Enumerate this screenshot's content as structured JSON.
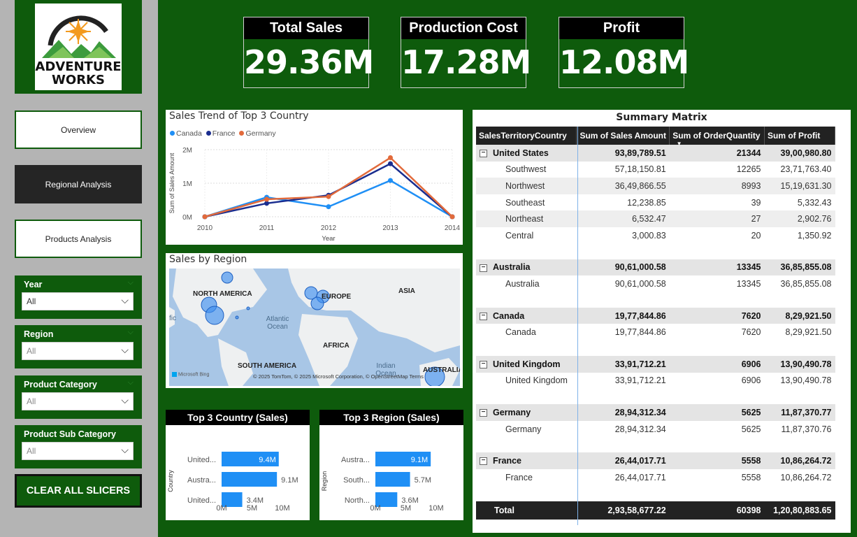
{
  "logo": {
    "line1": "ADVENTURE",
    "line2": "WORKS"
  },
  "nav": [
    {
      "label": "Overview",
      "active": false
    },
    {
      "label": "Regional Analysis",
      "active": true
    },
    {
      "label": "Products Analysis",
      "active": false
    }
  ],
  "slicers": [
    {
      "title": "Year",
      "value": "All"
    },
    {
      "title": "Region",
      "value": "All"
    },
    {
      "title": "Product Category",
      "value": "All"
    },
    {
      "title": "Product Sub Category",
      "value": "All"
    }
  ],
  "clear_button": "CLEAR ALL SLICERS",
  "kpis": [
    {
      "title": "Total Sales",
      "value": "29.36M"
    },
    {
      "title": "Production Cost",
      "value": "17.28M"
    },
    {
      "title": "Profit",
      "value": "12.08M"
    }
  ],
  "trend": {
    "title": "Sales Trend of Top 3 Country",
    "legend": [
      "Canada",
      "France",
      "Germany"
    ],
    "colors": {
      "Canada": "#1f8ff5",
      "France": "#1a2d8f",
      "Germany": "#e26a3b"
    }
  },
  "map": {
    "title": "Sales by Region",
    "labels": {
      "na": "NORTH AMERICA",
      "eu": "EUROPE",
      "asia": "ASIA",
      "africa": "AFRICA",
      "sa": "SOUTH AMERICA",
      "au": "AUSTRALIA",
      "atlantic": "Atlantic Ocean",
      "indian": "Indian Ocean",
      "pacific": "fic"
    },
    "attribution": "© 2025 TomTom, © 2025 Microsoft Corporation, © OpenStreetMap Terms",
    "bing": "Microsoft Bing"
  },
  "top_country": {
    "title": "Top 3 Country (Sales)",
    "ylabel": "Country"
  },
  "top_region": {
    "title": "Top 3 Region (Sales)",
    "ylabel": "Region"
  },
  "chart_data": [
    {
      "type": "line",
      "title": "Sales Trend of Top 3 Country",
      "x": [
        2010,
        2011,
        2012,
        2013,
        2014
      ],
      "xlabel": "Year",
      "ylabel": "Sum of Sales Amount",
      "yticks": [
        "0M",
        "1M",
        "2M"
      ],
      "ylim": [
        0,
        2000000
      ],
      "series": [
        {
          "name": "Canada",
          "values": [
            0,
            580000,
            300000,
            1080000,
            0
          ]
        },
        {
          "name": "France",
          "values": [
            0,
            400000,
            640000,
            1580000,
            0
          ]
        },
        {
          "name": "Germany",
          "values": [
            0,
            520000,
            600000,
            1760000,
            0
          ]
        }
      ],
      "legend_position": "top-left"
    },
    {
      "type": "bar",
      "title": "Top 3 Country (Sales)",
      "categories": [
        "United...",
        "Austra...",
        "United..."
      ],
      "values": [
        9.4,
        9.1,
        3.4
      ],
      "data_labels": [
        "9.4M",
        "9.1M",
        "3.4M"
      ],
      "xticks": [
        "0M",
        "5M",
        "10M"
      ],
      "xlim": [
        0,
        10
      ],
      "ylabel": "Country"
    },
    {
      "type": "bar",
      "title": "Top 3 Region (Sales)",
      "categories": [
        "Austra...",
        "South...",
        "North..."
      ],
      "values": [
        9.1,
        5.7,
        3.6
      ],
      "data_labels": [
        "9.1M",
        "5.7M",
        "3.6M"
      ],
      "xticks": [
        "0M",
        "5M",
        "10M"
      ],
      "xlim": [
        0,
        10
      ],
      "ylabel": "Region"
    }
  ],
  "matrix": {
    "title": "Summary Matrix",
    "headers": [
      "SalesTerritoryCountry",
      "Sum of Sales Amount",
      "Sum of OrderQuantity",
      "Sum of Profit"
    ],
    "groups": [
      {
        "name": "United States",
        "sales": "93,89,789.51",
        "qty": "21344",
        "profit": "39,00,980.80",
        "rows": [
          {
            "name": "Southwest",
            "sales": "57,18,150.81",
            "qty": "12265",
            "profit": "23,71,763.40"
          },
          {
            "name": "Northwest",
            "sales": "36,49,866.55",
            "qty": "8993",
            "profit": "15,19,631.30"
          },
          {
            "name": "Southeast",
            "sales": "12,238.85",
            "qty": "39",
            "profit": "5,332.43"
          },
          {
            "name": "Northeast",
            "sales": "6,532.47",
            "qty": "27",
            "profit": "2,902.76"
          },
          {
            "name": "Central",
            "sales": "3,000.83",
            "qty": "20",
            "profit": "1,350.92"
          }
        ]
      },
      {
        "name": "Australia",
        "sales": "90,61,000.58",
        "qty": "13345",
        "profit": "36,85,855.08",
        "rows": [
          {
            "name": "Australia",
            "sales": "90,61,000.58",
            "qty": "13345",
            "profit": "36,85,855.08"
          }
        ]
      },
      {
        "name": "Canada",
        "sales": "19,77,844.86",
        "qty": "7620",
        "profit": "8,29,921.50",
        "rows": [
          {
            "name": "Canada",
            "sales": "19,77,844.86",
            "qty": "7620",
            "profit": "8,29,921.50"
          }
        ]
      },
      {
        "name": "United Kingdom",
        "sales": "33,91,712.21",
        "qty": "6906",
        "profit": "13,90,490.78",
        "rows": [
          {
            "name": "United Kingdom",
            "sales": "33,91,712.21",
            "qty": "6906",
            "profit": "13,90,490.78"
          }
        ]
      },
      {
        "name": "Germany",
        "sales": "28,94,312.34",
        "qty": "5625",
        "profit": "11,87,370.77",
        "rows": [
          {
            "name": "Germany",
            "sales": "28,94,312.34",
            "qty": "5625",
            "profit": "11,87,370.76"
          }
        ]
      },
      {
        "name": "France",
        "sales": "26,44,017.71",
        "qty": "5558",
        "profit": "10,86,264.72",
        "rows": [
          {
            "name": "France",
            "sales": "26,44,017.71",
            "qty": "5558",
            "profit": "10,86,264.72"
          }
        ]
      }
    ],
    "total": {
      "label": "Total",
      "sales": "2,93,58,677.22",
      "qty": "60398",
      "profit": "1,20,80,883.65"
    }
  }
}
